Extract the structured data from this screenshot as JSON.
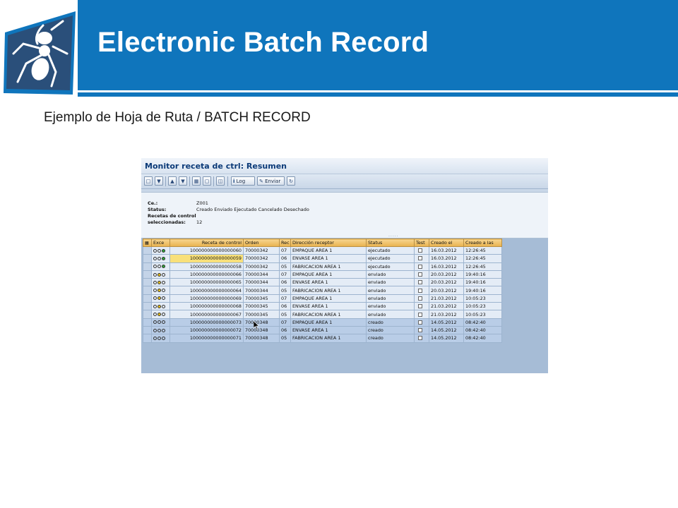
{
  "slide": {
    "title": "Electronic Batch Record",
    "subtitle": "Ejemplo de Hoja de Ruta / BATCH RECORD"
  },
  "sap": {
    "title": "Monitor receta de ctrl: Resumen",
    "toolbar": {
      "log_label": "Log",
      "enviar_label": "Enviar"
    },
    "info": {
      "ce_key": "Ce.:",
      "ce_value": "Z001",
      "status_key": "Status:",
      "status_value": "Creado Enviado Ejecutado Cancelado Desechado",
      "recetas_key": "Recetas de control",
      "seleccionadas_key": "seleccionadas:",
      "seleccionadas_value": "12"
    },
    "table": {
      "headers": {
        "exce": "Exce",
        "receta": "Receta de control",
        "orden": "Orden",
        "rec": "Rec",
        "direccion": "Dirección receptor",
        "status": "Status",
        "test": "Test",
        "creado_el": "Creado el",
        "creado_a_las": "Creado a las"
      },
      "rows": [
        {
          "exce": "green",
          "receta": "100000000000000060",
          "orden": "70000342",
          "rec": "07",
          "direccion": "EMPAQUE AREA 1",
          "status": "ejecutado",
          "creado_el": "16.03.2012",
          "creado_a_las": "12:26:45"
        },
        {
          "exce": "green",
          "receta": "100000000000000059",
          "orden": "70000342",
          "rec": "06",
          "direccion": "ENVASE AREA 1",
          "status": "ejecutado",
          "creado_el": "16.03.2012",
          "creado_a_las": "12:26:45"
        },
        {
          "exce": "green",
          "receta": "100000000000000058",
          "orden": "70000342",
          "rec": "05",
          "direccion": "FABRICACION AREA 1",
          "status": "ejecutado",
          "creado_el": "16.03.2012",
          "creado_a_las": "12:26:45"
        },
        {
          "exce": "yellow",
          "receta": "100000000000000066",
          "orden": "70000344",
          "rec": "07",
          "direccion": "EMPAQUE AREA 1",
          "status": "enviado",
          "creado_el": "20.03.2012",
          "creado_a_las": "19:40:16"
        },
        {
          "exce": "yellow",
          "receta": "100000000000000065",
          "orden": "70000344",
          "rec": "06",
          "direccion": "ENVASE AREA 1",
          "status": "enviado",
          "creado_el": "20.03.2012",
          "creado_a_las": "19:40:16"
        },
        {
          "exce": "yellow",
          "receta": "100000000000000064",
          "orden": "70000344",
          "rec": "05",
          "direccion": "FABRICACION AREA 1",
          "status": "enviado",
          "creado_el": "20.03.2012",
          "creado_a_las": "19:40:16"
        },
        {
          "exce": "yellow",
          "receta": "100000000000000069",
          "orden": "70000345",
          "rec": "07",
          "direccion": "EMPAQUE AREA 1",
          "status": "enviado",
          "creado_el": "21.03.2012",
          "creado_a_las": "10:05:23"
        },
        {
          "exce": "yellow",
          "receta": "100000000000000068",
          "orden": "70000345",
          "rec": "06",
          "direccion": "ENVASE AREA 1",
          "status": "enviado",
          "creado_el": "21.03.2012",
          "creado_a_las": "10:05:23"
        },
        {
          "exce": "yellow",
          "receta": "100000000000000067",
          "orden": "70000345",
          "rec": "05",
          "direccion": "FABRICACION AREA 1",
          "status": "enviado",
          "creado_el": "21.03.2012",
          "creado_a_las": "10:05:23"
        },
        {
          "exce": "none",
          "receta": "100000000000000073",
          "orden": "70000348",
          "rec": "07",
          "direccion": "EMPAQUE AREA 1",
          "status": "creado",
          "creado_el": "14.05.2012",
          "creado_a_las": "08:42:40"
        },
        {
          "exce": "none",
          "receta": "100000000000000072",
          "orden": "70000348",
          "rec": "06",
          "direccion": "ENVASE AREA 1",
          "status": "creado",
          "creado_el": "14.05.2012",
          "creado_a_las": "08:42:40"
        },
        {
          "exce": "none",
          "receta": "100000000000000071",
          "orden": "70000348",
          "rec": "05",
          "direccion": "FABRICACION AREA 1",
          "status": "creado",
          "creado_el": "14.05.2012",
          "creado_a_las": "08:42:40"
        }
      ]
    }
  },
  "colors": {
    "brand_blue": "#0f75bc",
    "header_orange": "#e8b24d",
    "highlight_yellow": "#f8e07a",
    "lamp_green": "#2fa839",
    "lamp_yellow": "#e9c11a"
  },
  "icons": {
    "logo": "ant-logo-icon",
    "cursor": "mouse-pointer-icon"
  }
}
